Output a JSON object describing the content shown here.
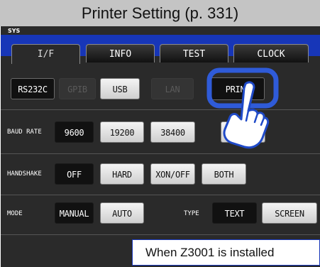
{
  "caption": "Printer Setting (p. 331)",
  "screen_label": "SYS",
  "tabs": [
    "I/F",
    "INFO",
    "TEST",
    "CLOCK"
  ],
  "interfaces": {
    "rs232c": "RS232C",
    "gpib": "GPIB",
    "usb": "USB",
    "lan": "LAN",
    "print": "PRINT"
  },
  "baud_rate": {
    "label": "BAUD RATE",
    "options": [
      "9600",
      "19200",
      "38400",
      "00"
    ]
  },
  "handshake": {
    "label": "HANDSHAKE",
    "options": [
      "OFF",
      "HARD",
      "XON/OFF",
      "BOTH"
    ]
  },
  "mode": {
    "label": "MODE",
    "options": [
      "MANUAL",
      "AUTO"
    ]
  },
  "type": {
    "label": "TYPE",
    "options": [
      "TEXT",
      "SCREEN"
    ]
  },
  "note": "When Z3001 is installed",
  "colors": {
    "accent": "#1736b8",
    "highlight_ring": "#2f5bd8",
    "hand_outline": "#1f4ac8"
  },
  "icons": [
    "pointing-hand-icon"
  ]
}
